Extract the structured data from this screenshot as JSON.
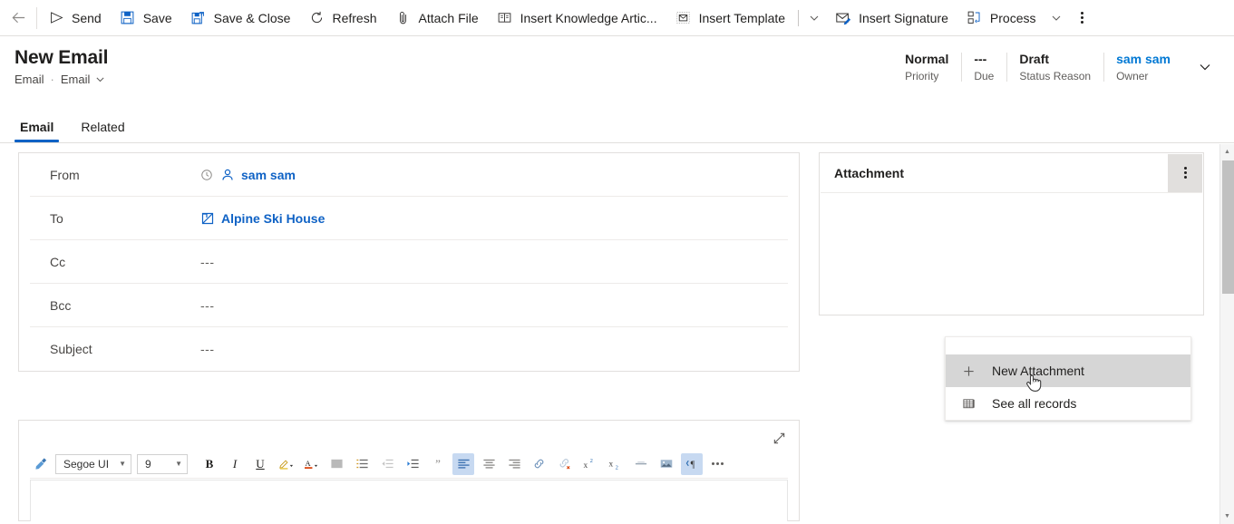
{
  "commandbar": {
    "back_label": "Back",
    "items": [
      {
        "label": "Send",
        "icon": "send-icon"
      },
      {
        "label": "Save",
        "icon": "save-icon"
      },
      {
        "label": "Save & Close",
        "icon": "save-close-icon"
      },
      {
        "label": "Refresh",
        "icon": "refresh-icon"
      },
      {
        "label": "Attach File",
        "icon": "paperclip-icon"
      },
      {
        "label": "Insert Knowledge Artic...",
        "icon": "book-icon"
      },
      {
        "label": "Insert Template",
        "icon": "template-icon"
      },
      {
        "label": "Insert Signature",
        "icon": "signature-icon"
      },
      {
        "label": "Process",
        "icon": "process-icon"
      }
    ],
    "overflow_label": "More commands"
  },
  "header": {
    "title": "New Email",
    "breadcrumb_entity": "Email",
    "breadcrumb_form": "Email",
    "separator": "·",
    "fields": [
      {
        "value": "Normal",
        "label": "Priority",
        "link": false
      },
      {
        "value": "---",
        "label": "Due",
        "link": false
      },
      {
        "value": "Draft",
        "label": "Status Reason",
        "link": false
      },
      {
        "value": "sam sam",
        "label": "Owner",
        "link": true
      }
    ],
    "expand_label": "Expand header"
  },
  "tabs": [
    {
      "label": "Email",
      "active": true
    },
    {
      "label": "Related",
      "active": false
    }
  ],
  "email_form": {
    "rows": [
      {
        "label": "From",
        "value": "sam sam",
        "type": "person",
        "icon": "contact-icon",
        "prefix_icon": "clock-icon"
      },
      {
        "label": "To",
        "value": "Alpine Ski House",
        "type": "account",
        "icon": "account-icon",
        "prefix_icon": ""
      },
      {
        "label": "Cc",
        "value": "---",
        "type": "empty",
        "icon": "",
        "prefix_icon": ""
      },
      {
        "label": "Bcc",
        "value": "---",
        "type": "empty",
        "icon": "",
        "prefix_icon": ""
      },
      {
        "label": "Subject",
        "value": "---",
        "type": "empty",
        "icon": "",
        "prefix_icon": ""
      }
    ]
  },
  "editor": {
    "expand_label": "Expand editor",
    "font_family": "Segoe UI",
    "font_size": "9",
    "body_text": "",
    "tools": [
      {
        "name": "format-painter-icon",
        "glyph": "brush",
        "active": false
      },
      {
        "name": "bold-icon",
        "glyph": "B",
        "active": false
      },
      {
        "name": "italic-icon",
        "glyph": "I",
        "active": false
      },
      {
        "name": "underline-icon",
        "glyph": "U",
        "active": false
      },
      {
        "name": "highlight-color-icon",
        "glyph": "highlight",
        "active": false
      },
      {
        "name": "font-color-icon",
        "glyph": "fontcolor",
        "active": false
      },
      {
        "name": "bullet-list-icon",
        "glyph": "bullets",
        "active": false
      },
      {
        "name": "numbered-list-icon",
        "glyph": "numbers",
        "active": false
      },
      {
        "name": "decrease-indent-icon",
        "glyph": "outdent",
        "active": false
      },
      {
        "name": "increase-indent-icon",
        "glyph": "indent",
        "active": false
      },
      {
        "name": "blockquote-icon",
        "glyph": "quote",
        "active": false
      },
      {
        "name": "align-left-icon",
        "glyph": "alignleft",
        "active": true
      },
      {
        "name": "align-center-icon",
        "glyph": "aligncenter",
        "active": false
      },
      {
        "name": "align-right-icon",
        "glyph": "alignright",
        "active": false
      },
      {
        "name": "insert-link-icon",
        "glyph": "link",
        "active": false
      },
      {
        "name": "remove-link-icon",
        "glyph": "unlink",
        "active": false
      },
      {
        "name": "superscript-icon",
        "glyph": "sup",
        "active": false
      },
      {
        "name": "subscript-icon",
        "glyph": "sub",
        "active": false
      },
      {
        "name": "horizontal-rule-icon",
        "glyph": "hr",
        "active": false
      },
      {
        "name": "insert-image-icon",
        "glyph": "image",
        "active": false
      },
      {
        "name": "text-direction-icon",
        "glyph": "rtl",
        "active": true
      }
    ],
    "more_label": "More formatting options"
  },
  "attachment_panel": {
    "title": "Attachment",
    "menu_label": "More commands",
    "menu_items": [
      {
        "label": "New Attachment",
        "icon": "plus-icon",
        "hovered": true
      },
      {
        "label": "See all records",
        "icon": "grid-icon",
        "hovered": false
      }
    ]
  },
  "colors": {
    "accent": "#0f62c5",
    "link": "#0078d4",
    "border": "#e1dfdd",
    "text": "#201f1e",
    "muted": "#605e5c",
    "hover_bg": "#d6d6d6",
    "toolbar_active": "#c7d9f1"
  }
}
